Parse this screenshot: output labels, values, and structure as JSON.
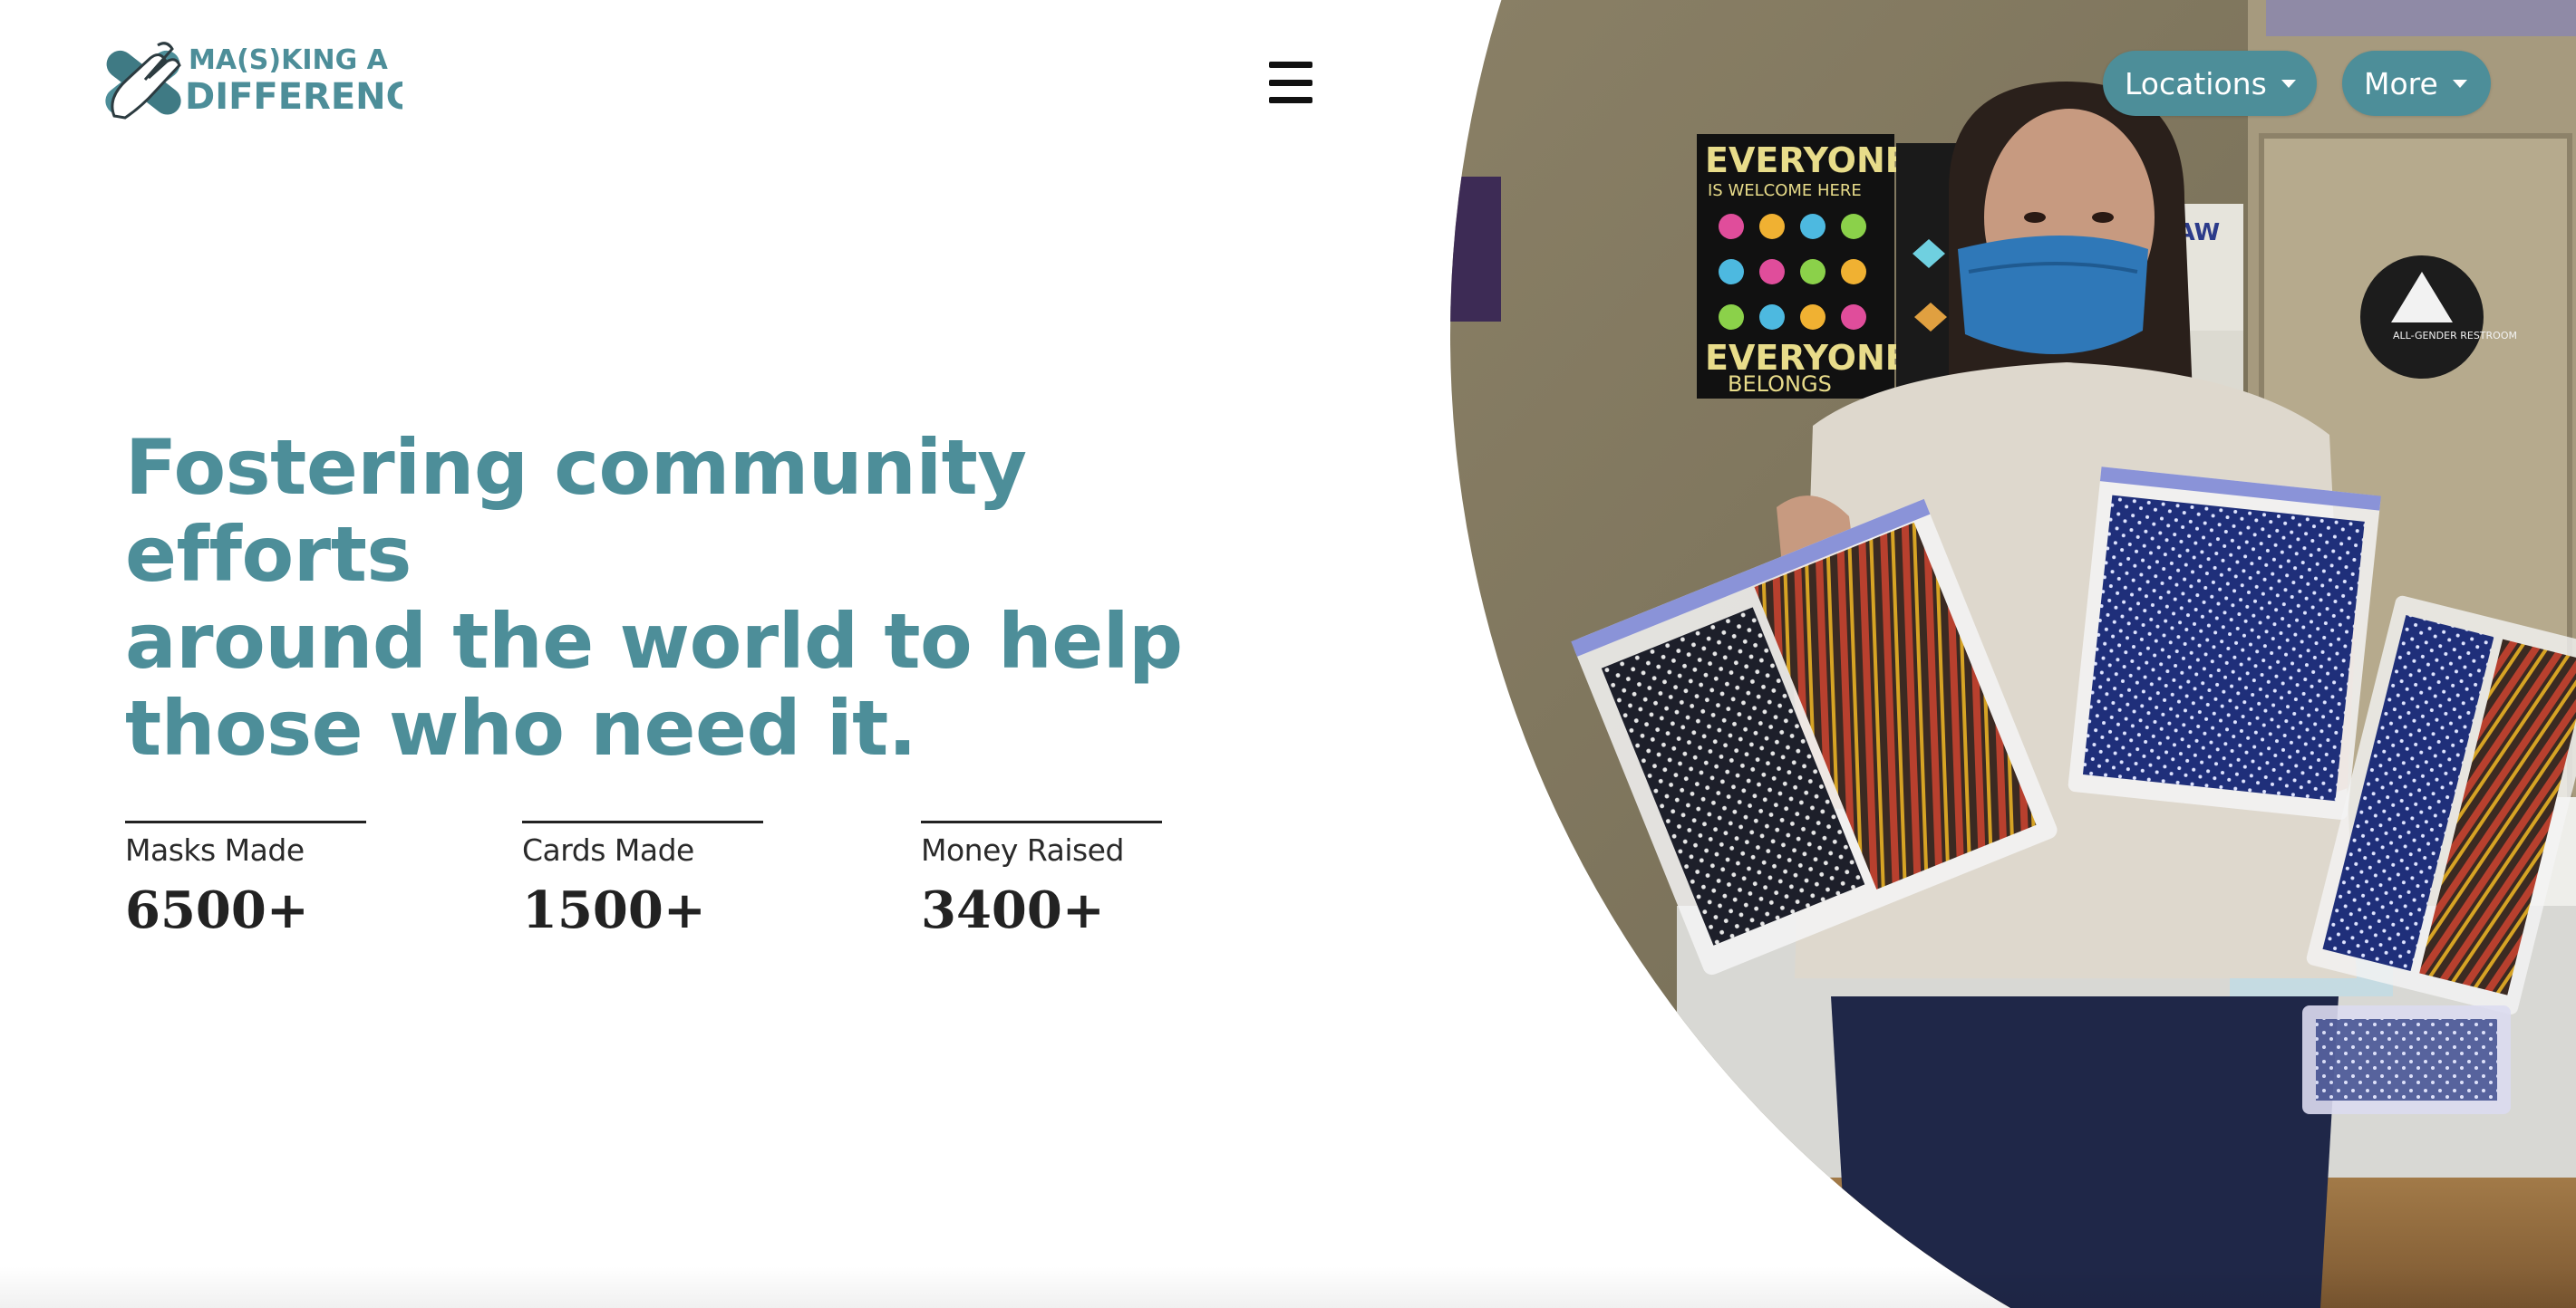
{
  "brand": {
    "logo_line1": "MA(S)KING A",
    "logo_line2": "DIFFERENCE",
    "accent_color": "#4d8e99",
    "logo_icon": "crossed-hands-bandage-icon"
  },
  "nav": {
    "menu_icon": "hamburger-icon",
    "locations_label": "Locations",
    "more_label": "More"
  },
  "hero": {
    "headline_line1": "Fostering community efforts",
    "headline_line2": "around the world to help",
    "headline_line3": "those who need it.",
    "photo_poster_text1": "EVERYONE",
    "photo_poster_text2": "IS WELCOME HERE",
    "photo_poster_text3": "EVERYONE",
    "photo_poster_text4": "BELONGS",
    "photo_sign_law": "LAW",
    "photo_restroom_sign": "ALL-GENDER RESTROOM"
  },
  "stats": [
    {
      "label": "Masks Made",
      "value": "6500+"
    },
    {
      "label": "Cards Made",
      "value": "1500+"
    },
    {
      "label": "Money Raised",
      "value": "3400+"
    }
  ]
}
